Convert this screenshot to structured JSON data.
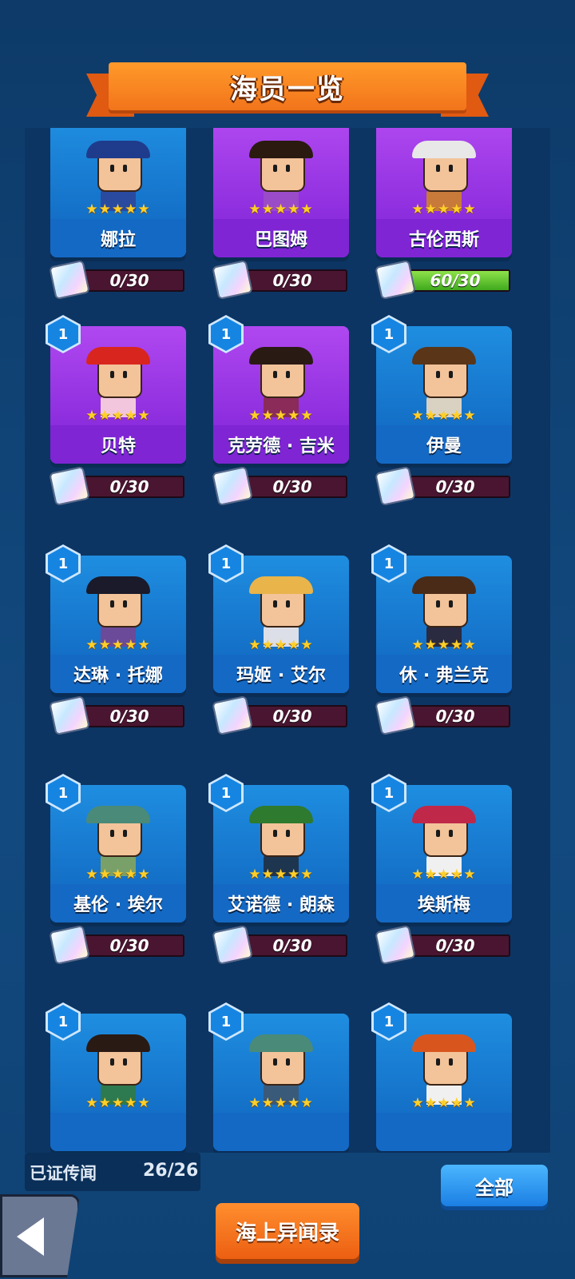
{
  "header": {
    "title": "海员一览"
  },
  "stars": "★★★★★",
  "crew": [
    {
      "name": "娜拉",
      "progress": "0/30",
      "fill": 0,
      "color": "blue",
      "level": "",
      "hat": "#1f3c8c",
      "outfit": "#2a4aa0"
    },
    {
      "name": "巴图姆",
      "progress": "0/30",
      "fill": 0,
      "color": "purple",
      "level": "",
      "hat": "#2a1a10",
      "outfit": "#9a4bc8"
    },
    {
      "name": "古伦西斯",
      "progress": "60/30",
      "fill": 1,
      "color": "purple",
      "level": "",
      "hat": "#e8e8e8",
      "outfit": "#c77a3a"
    },
    {
      "name": "贝特",
      "progress": "0/30",
      "fill": 0,
      "color": "purple",
      "level": "1",
      "hat": "#d8261e",
      "outfit": "#f2c7de"
    },
    {
      "name": "克劳德 · 吉米",
      "progress": "0/30",
      "fill": 0,
      "color": "purple",
      "level": "1",
      "hat": "#2a1a14",
      "outfit": "#8a2b5a"
    },
    {
      "name": "伊曼",
      "progress": "0/30",
      "fill": 0,
      "color": "blue",
      "level": "1",
      "hat": "#5a3518",
      "outfit": "#d9d2c2"
    },
    {
      "name": "达琳 · 托娜",
      "progress": "0/30",
      "fill": 0,
      "color": "blue",
      "level": "1",
      "hat": "#1a1a2a",
      "outfit": "#6b4a9a"
    },
    {
      "name": "玛姬 · 艾尔",
      "progress": "0/30",
      "fill": 0,
      "color": "blue",
      "level": "1",
      "hat": "#e9b44a",
      "outfit": "#dcdfe8"
    },
    {
      "name": "休 · 弗兰克",
      "progress": "0/30",
      "fill": 0,
      "color": "blue",
      "level": "1",
      "hat": "#4a2b18",
      "outfit": "#2a2a40"
    },
    {
      "name": "基伦 · 埃尔",
      "progress": "0/30",
      "fill": 0,
      "color": "blue",
      "level": "1",
      "hat": "#4a8a78",
      "outfit": "#7aa06a"
    },
    {
      "name": "艾诺德 · 朗森",
      "progress": "0/30",
      "fill": 0,
      "color": "blue",
      "level": "1",
      "hat": "#2e7a2e",
      "outfit": "#1e3550"
    },
    {
      "name": "埃斯梅",
      "progress": "0/30",
      "fill": 0,
      "color": "blue",
      "level": "1",
      "hat": "#c0284a",
      "outfit": "#f0f0f0"
    },
    {
      "name": "",
      "progress": "",
      "fill": 0,
      "color": "blue",
      "level": "1",
      "hat": "#2a1a14",
      "outfit": "#2e7a50"
    },
    {
      "name": "",
      "progress": "",
      "fill": 0,
      "color": "blue",
      "level": "1",
      "hat": "#4a8a78",
      "outfit": "#3a5a7a"
    },
    {
      "name": "",
      "progress": "",
      "fill": 0,
      "color": "blue",
      "level": "1",
      "hat": "#d8561e",
      "outfit": "#f0f0f0"
    }
  ],
  "footer": {
    "proven_label": "已证传闻",
    "proven_count": "26/26",
    "all_button": "全部",
    "main_button": "海上异闻录",
    "back_icon": "back-arrow-icon"
  }
}
